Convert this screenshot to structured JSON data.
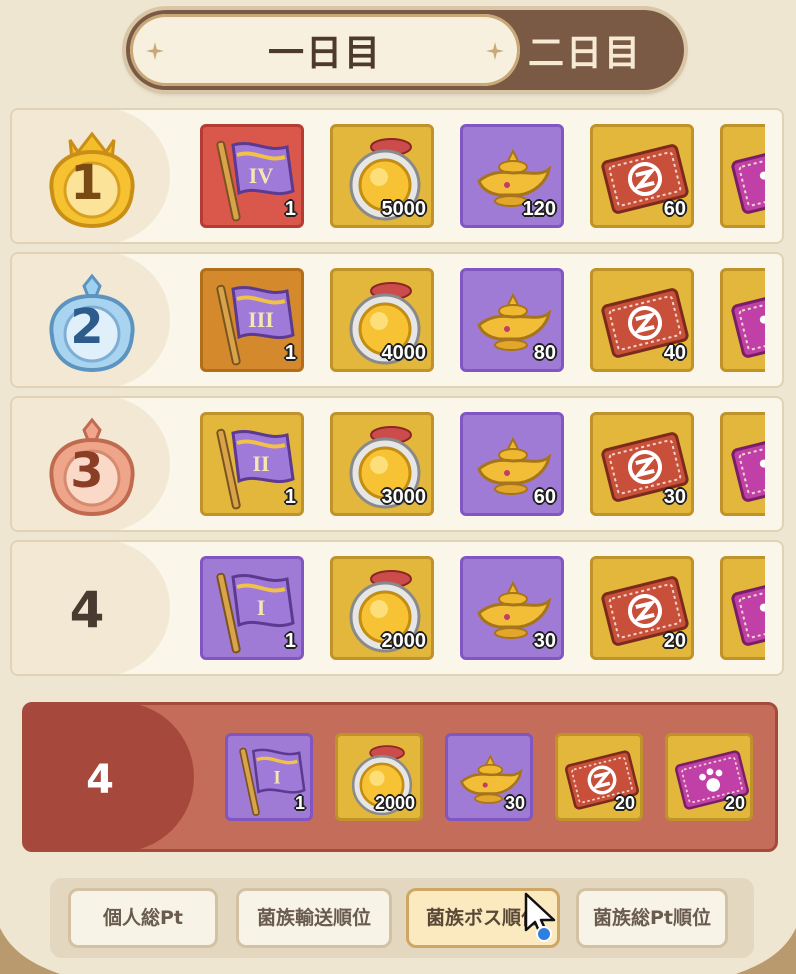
{
  "tabs": {
    "day1": "一日目",
    "day2": "二日目",
    "active": "day1"
  },
  "ranks": [
    {
      "rank": "1",
      "badge": "gold-crown",
      "items": [
        {
          "icon": "flag-iv-icon",
          "tier": "IV",
          "bg": "red",
          "qty": "1"
        },
        {
          "icon": "gold-coin-icon",
          "bg": "gold",
          "qty": "5000"
        },
        {
          "icon": "magic-lamp-icon",
          "bg": "purple",
          "qty": "120"
        },
        {
          "icon": "red-ticket-icon",
          "bg": "gold",
          "qty": "60"
        },
        {
          "icon": "paw-ticket-icon",
          "bg": "gold",
          "qty": ""
        }
      ]
    },
    {
      "rank": "2",
      "badge": "silver",
      "items": [
        {
          "icon": "flag-iii-icon",
          "tier": "III",
          "bg": "orange",
          "qty": "1"
        },
        {
          "icon": "gold-coin-icon",
          "bg": "gold",
          "qty": "4000"
        },
        {
          "icon": "magic-lamp-icon",
          "bg": "purple",
          "qty": "80"
        },
        {
          "icon": "red-ticket-icon",
          "bg": "gold",
          "qty": "40"
        },
        {
          "icon": "paw-ticket-icon",
          "bg": "gold",
          "qty": ""
        }
      ]
    },
    {
      "rank": "3",
      "badge": "bronze",
      "items": [
        {
          "icon": "flag-ii-icon",
          "tier": "II",
          "bg": "gold",
          "qty": "1"
        },
        {
          "icon": "gold-coin-icon",
          "bg": "gold",
          "qty": "3000"
        },
        {
          "icon": "magic-lamp-icon",
          "bg": "purple",
          "qty": "60"
        },
        {
          "icon": "red-ticket-icon",
          "bg": "gold",
          "qty": "30"
        },
        {
          "icon": "paw-ticket-icon",
          "bg": "gold",
          "qty": ""
        }
      ]
    },
    {
      "rank": "4",
      "badge": "none",
      "items": [
        {
          "icon": "flag-i-icon",
          "tier": "I",
          "bg": "purple",
          "qty": "1"
        },
        {
          "icon": "gold-coin-icon",
          "bg": "gold",
          "qty": "2000"
        },
        {
          "icon": "magic-lamp-icon",
          "bg": "purple",
          "qty": "30"
        },
        {
          "icon": "red-ticket-icon",
          "bg": "gold",
          "qty": "20"
        },
        {
          "icon": "paw-ticket-icon",
          "bg": "gold",
          "qty": ""
        }
      ]
    }
  ],
  "my_rank": {
    "rank": "4",
    "items": [
      {
        "icon": "flag-i-icon",
        "tier": "I",
        "bg": "purple",
        "qty": "1"
      },
      {
        "icon": "gold-coin-icon",
        "bg": "gold",
        "qty": "2000"
      },
      {
        "icon": "magic-lamp-icon",
        "bg": "purple",
        "qty": "30"
      },
      {
        "icon": "red-ticket-icon",
        "bg": "gold",
        "qty": "20"
      },
      {
        "icon": "paw-ticket-icon",
        "bg": "gold",
        "qty": "20"
      }
    ]
  },
  "categories": [
    {
      "label": "個人総Pt",
      "active": false
    },
    {
      "label": "菌族輸送順位",
      "active": false
    },
    {
      "label": "菌族ボス順位",
      "active": true
    },
    {
      "label": "菌族総Pt順位",
      "active": false
    }
  ],
  "colors": {
    "accent": "#c46d5a",
    "frame": "#7a5a45"
  }
}
